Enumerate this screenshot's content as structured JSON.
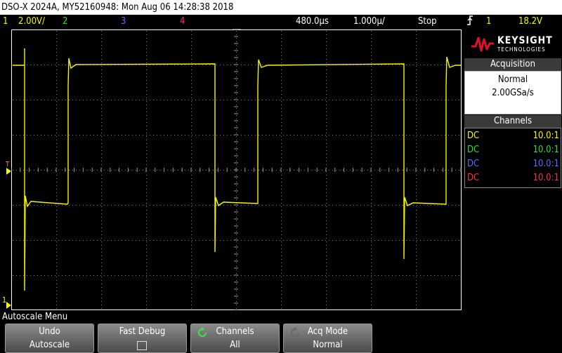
{
  "title": "DSO-X 2024A, MY52160948: Mon Aug 06 14:28:38 2018",
  "status": {
    "ch1_num": "1",
    "ch1_scale": "2.00V/",
    "ch2_num": "2",
    "ch3_num": "3",
    "ch4_num": "4",
    "time_delay": "480.0µs",
    "time_scale": "1.000µ/",
    "run_state": "Stop",
    "trigger_icon": "trigger-edge-icon",
    "trigger_ch": "1",
    "trigger_level": "18.2V"
  },
  "colors": {
    "ch1": "#f6f600",
    "ch2": "#29e02e",
    "ch3": "#5a6cff",
    "ch4": "#ff2860",
    "orange": "#ff8c1a"
  },
  "logo": {
    "brand": "KEYSIGHT",
    "sub": "TECHNOLOGIES"
  },
  "acquisition": {
    "header": "Acquisition",
    "mode": "Normal",
    "rate": "2.00GSa/s"
  },
  "channels": {
    "header": "Channels",
    "rows": [
      {
        "coupling": "DC",
        "probe": "10.0:1"
      },
      {
        "coupling": "DC",
        "probe": "10.0:1"
      },
      {
        "coupling": "DC",
        "probe": "10.0:1"
      },
      {
        "coupling": "DC",
        "probe": "10.0:1"
      }
    ]
  },
  "grid_markers": {
    "trigger_level_label": "T",
    "ch1_ground_label": "1"
  },
  "menu_title": "Autoscale Menu",
  "softkeys": [
    {
      "line1": "Undo",
      "line2": "Autoscale"
    },
    {
      "line1": "Fast Debug",
      "line2": ""
    },
    {
      "line1": "Channels",
      "line2": "All",
      "icon": "rotate-knob-icon"
    },
    {
      "line1": "Acq Mode",
      "line2": "Normal",
      "icon": "rotate-knob-icon"
    }
  ]
}
